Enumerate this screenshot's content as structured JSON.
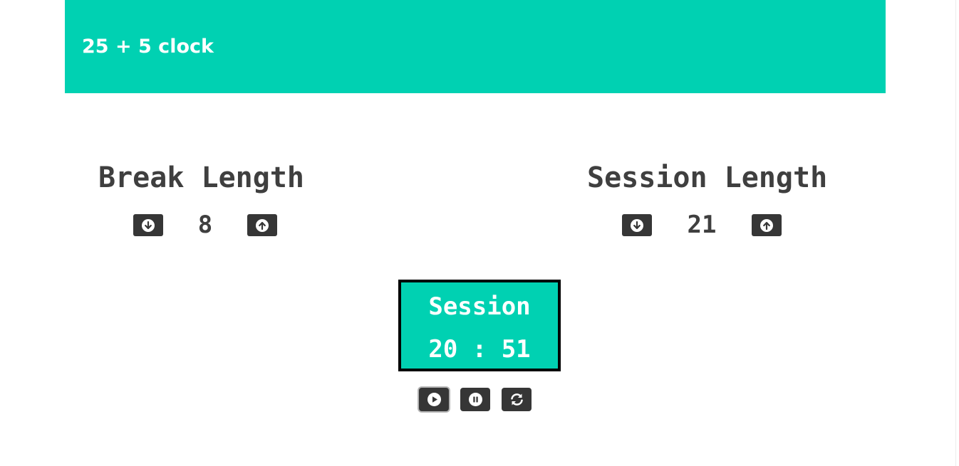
{
  "header": {
    "title": "25 + 5 clock",
    "background_color": "#00d1b2"
  },
  "break": {
    "title": "Break Length",
    "value": "8",
    "decrement_icon": "arrow-circle-down-icon",
    "increment_icon": "arrow-circle-up-icon"
  },
  "session": {
    "title": "Session Length",
    "value": "21",
    "decrement_icon": "arrow-circle-down-icon",
    "increment_icon": "arrow-circle-up-icon"
  },
  "timer": {
    "label": "Session",
    "time": "20 : 51",
    "background_color": "#00d1b2",
    "border_color": "#000000"
  },
  "controls": {
    "play_icon": "play-circle-icon",
    "pause_icon": "pause-circle-icon",
    "reset_icon": "sync-icon"
  },
  "colors": {
    "button_dark": "#363636",
    "text_dark": "#3f3f3f"
  }
}
